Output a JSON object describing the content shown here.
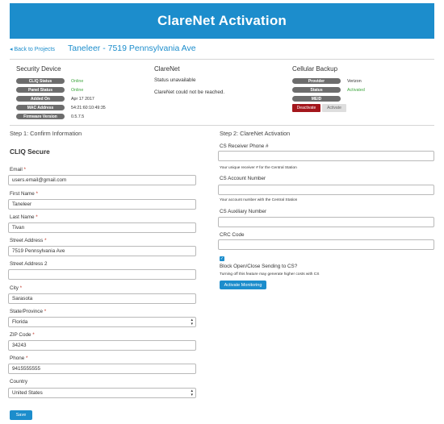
{
  "header": {
    "title": "ClareNet Activation"
  },
  "nav": {
    "back_label": "Back to Projects",
    "project_title": "Taneleer - 7519 Pennsylvania Ave"
  },
  "security_device": {
    "title": "Security Device",
    "rows": [
      {
        "label": "CLIQ Status",
        "value": "Online",
        "status": "ok"
      },
      {
        "label": "Panel Status",
        "value": "Online",
        "status": "ok"
      },
      {
        "label": "Added On",
        "value": "Apr 17 2017",
        "status": ""
      },
      {
        "label": "MAC Address",
        "value": "54:21:60:10:49:35",
        "status": ""
      },
      {
        "label": "Firmware Version",
        "value": "0.5.7.5",
        "status": ""
      }
    ]
  },
  "clarenet": {
    "title": "ClareNet",
    "status_text": "Status unavailable",
    "message": "ClareNet could not be reached."
  },
  "cellular": {
    "title": "Cellular Backup",
    "rows": [
      {
        "label": "Provider",
        "value": "Verizon",
        "status": ""
      },
      {
        "label": "Status",
        "value": "Activated",
        "status": "ok"
      },
      {
        "label": "MEID",
        "value": "",
        "status": ""
      }
    ],
    "deactivate_label": "Deactivate",
    "activate_label": "Activate"
  },
  "step1": {
    "title": "Step 1: Confirm Information",
    "subtitle": "CLIQ Secure",
    "email_label": "Email",
    "email_value": "users.email@gmail.com",
    "first_name_label": "First Name",
    "first_name_value": "Taneleer",
    "last_name_label": "Last Name",
    "last_name_value": "Tivan",
    "street_label": "Street Address",
    "street_value": "7519 Pennsylvania Ave",
    "street2_label": "Street Address 2",
    "street2_value": "",
    "city_label": "City",
    "city_value": "Sarasota",
    "state_label": "State/Province",
    "state_value": "Florida",
    "zip_label": "ZIP Code",
    "zip_value": "34243",
    "phone_label": "Phone",
    "phone_value": "9415555555",
    "country_label": "Country",
    "country_value": "United States",
    "required_mark": "*",
    "save_label": "Save"
  },
  "step2": {
    "title": "Step 2: ClareNet Activation",
    "receiver_label": "CS Receiver Phone #",
    "receiver_hint": "Your unique receiver # for the Central Station",
    "account_label": "CS Account Number",
    "account_hint": "Your account number with the Central Station",
    "aux_label": "CS Auxiliary Number",
    "crc_label": "CRC Code",
    "block_label": "Block Open/Close Sending to CS?",
    "block_hint": "Turning off this feature may generate higher costs with CS",
    "checkbox_mark": "✓",
    "activate_monitoring_label": "Activate Monitoring"
  },
  "icons": {
    "select_arrow": "up-down-chevron-icon"
  },
  "colors": {
    "accent": "#1c8dcc",
    "online": "#3ea63e",
    "danger": "#a3161c",
    "pill": "#6d6d6d"
  }
}
